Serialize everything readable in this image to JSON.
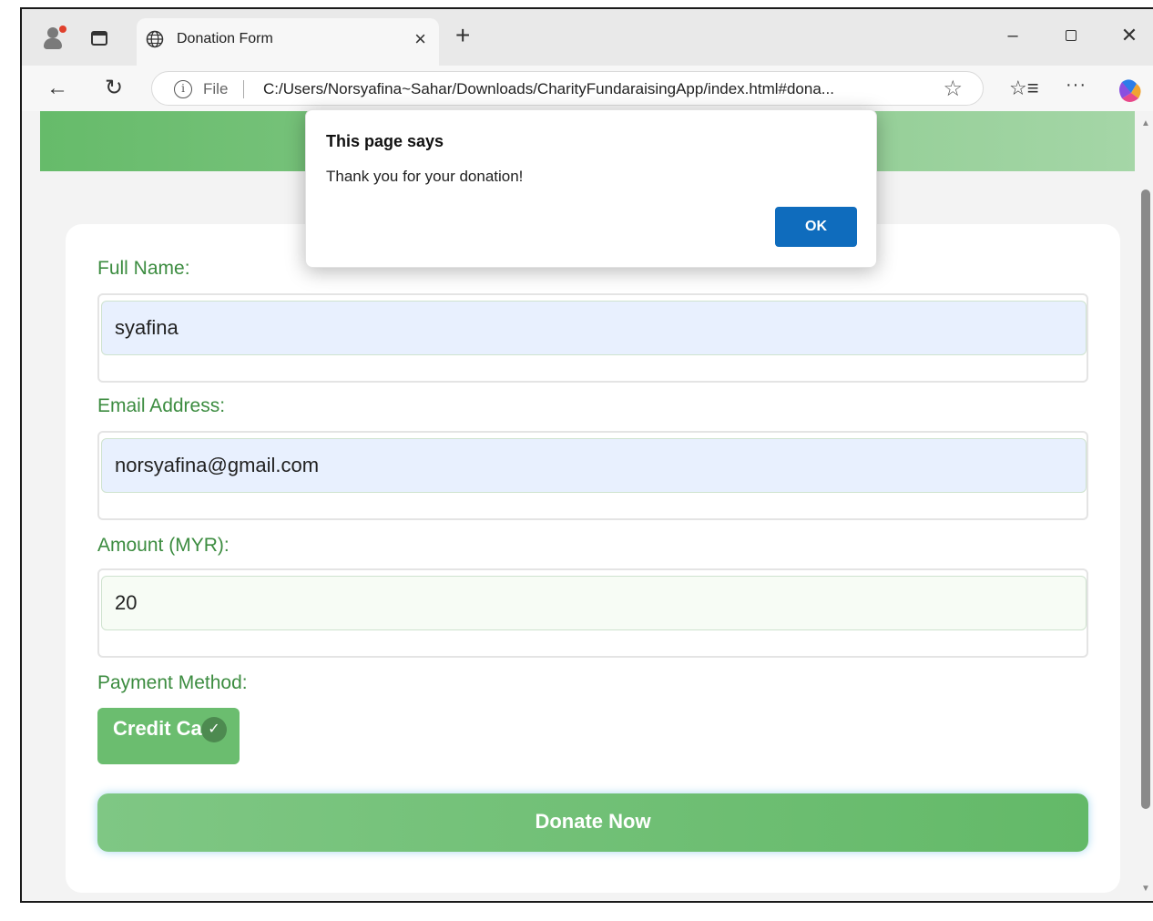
{
  "browser": {
    "tab_title": "Donation Form",
    "tab_close": "×",
    "new_tab": "+",
    "url_prefix": "File",
    "url": "C:/Users/Norsyafina~Sahar/Downloads/CharityFundaraisingApp/index.html#dona...",
    "more": "···",
    "min": "–",
    "close": "✕",
    "back": "←",
    "reload": "↻",
    "star": "☆",
    "favorites": "☆≡"
  },
  "form": {
    "full_name_label": "Full Name:",
    "full_name_value": "syafina",
    "email_label": "Email Address:",
    "email_value": "norsyafina@gmail.com",
    "amount_label": "Amount (MYR):",
    "amount_value": "20",
    "payment_label": "Payment Method:",
    "payment_value": "Credit Ca",
    "donate_label": "Donate Now"
  },
  "dialog": {
    "title": "This page says",
    "message": "Thank you for your donation!",
    "ok_label": "OK"
  },
  "colors": {
    "accent_green": "#66bb6a",
    "label_green": "#3c8c40",
    "dialog_button": "#0f6cbd"
  }
}
